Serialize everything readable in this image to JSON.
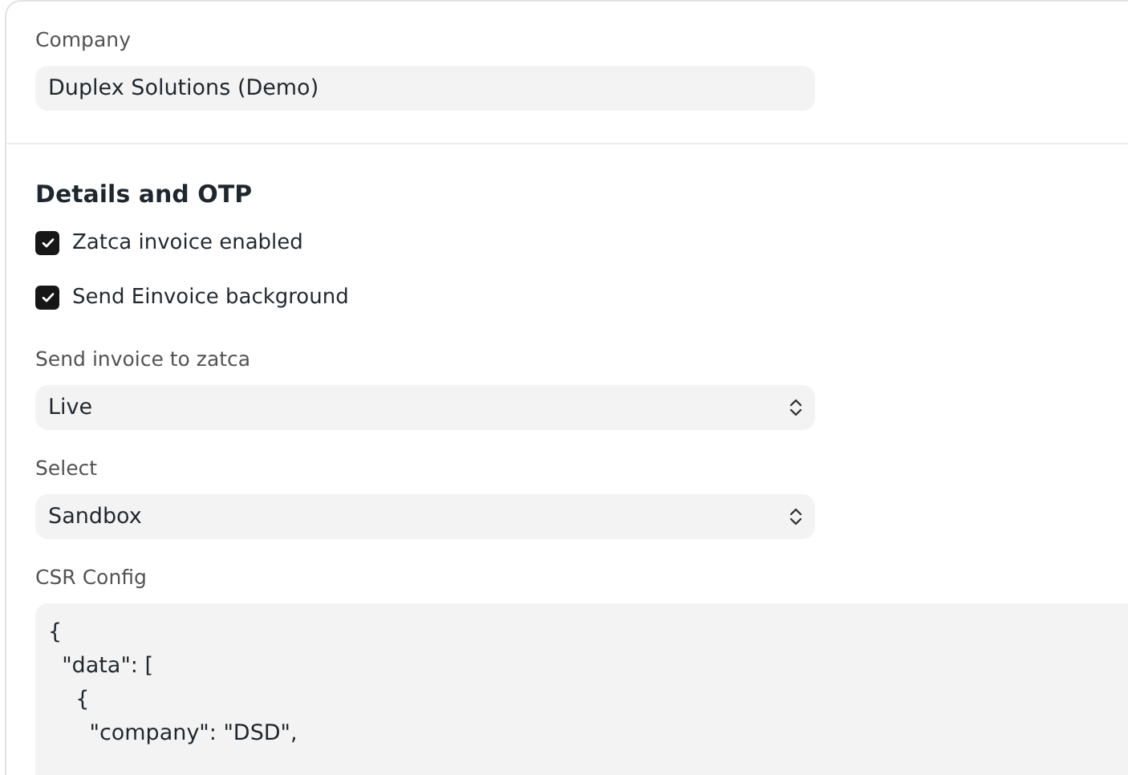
{
  "company": {
    "label": "Company",
    "value": "Duplex Solutions (Demo)"
  },
  "section": {
    "title": "Details and OTP",
    "checkboxes": [
      {
        "label": "Zatca invoice enabled",
        "checked": true
      },
      {
        "label": "Send Einvoice background",
        "checked": true
      }
    ],
    "selects": [
      {
        "label": "Send invoice to zatca",
        "value": "Live"
      },
      {
        "label": "Select",
        "value": "Sandbox"
      }
    ],
    "csr_config": {
      "label": "CSR Config",
      "value": "{\n  \"data\": [\n    {\n      \"company\": \"DSD\","
    }
  }
}
